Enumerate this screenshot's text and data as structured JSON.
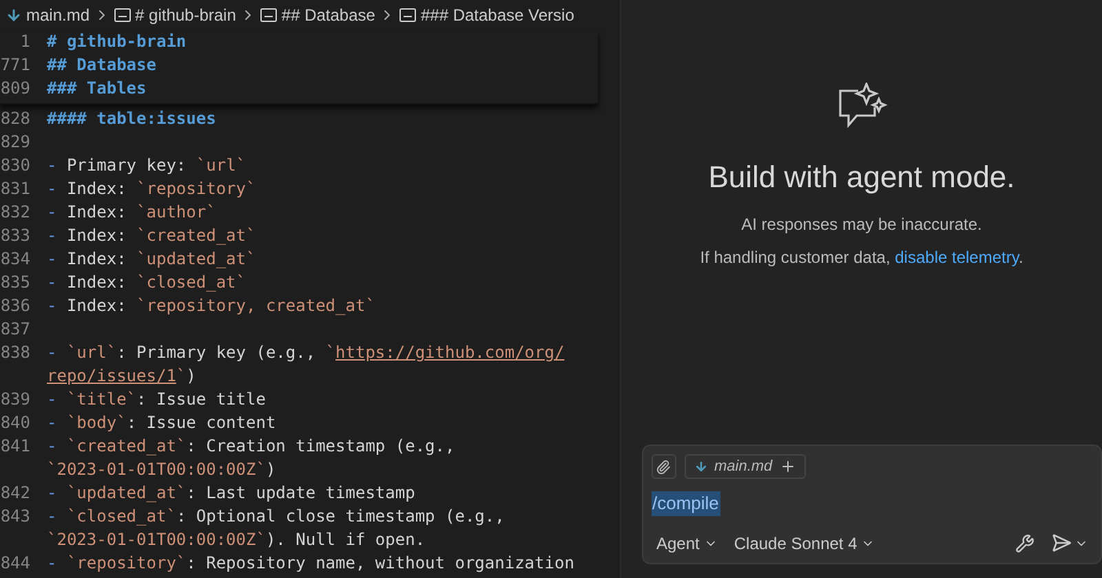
{
  "breadcrumb": [
    {
      "kind": "file",
      "label": "main.md"
    },
    {
      "kind": "symbol",
      "label": "# github-brain"
    },
    {
      "kind": "symbol",
      "label": "## Database"
    },
    {
      "kind": "symbol",
      "label": "### Database Versio"
    }
  ],
  "sticky_lines": [
    {
      "number": "1",
      "segments": [
        {
          "kind": "heading",
          "text": "# github-brain"
        }
      ]
    },
    {
      "number": "771",
      "segments": [
        {
          "kind": "heading",
          "text": "## Database"
        }
      ]
    },
    {
      "number": "809",
      "segments": [
        {
          "kind": "heading",
          "text": "### Tables"
        }
      ]
    }
  ],
  "lines": [
    {
      "number": "828",
      "segments": [
        {
          "kind": "heading",
          "text": "#### table:issues"
        }
      ]
    },
    {
      "number": "829"
    },
    {
      "number": "830",
      "segments": [
        {
          "kind": "marker",
          "text": "-"
        },
        {
          "kind": "text",
          "text": " Primary key: "
        },
        {
          "kind": "code",
          "text": "`url`"
        }
      ]
    },
    {
      "number": "831",
      "segments": [
        {
          "kind": "marker",
          "text": "-"
        },
        {
          "kind": "text",
          "text": " Index: "
        },
        {
          "kind": "code",
          "text": "`repository`"
        }
      ]
    },
    {
      "number": "832",
      "segments": [
        {
          "kind": "marker",
          "text": "-"
        },
        {
          "kind": "text",
          "text": " Index: "
        },
        {
          "kind": "code",
          "text": "`author`"
        }
      ]
    },
    {
      "number": "833",
      "segments": [
        {
          "kind": "marker",
          "text": "-"
        },
        {
          "kind": "text",
          "text": " Index: "
        },
        {
          "kind": "code",
          "text": "`created_at`"
        }
      ]
    },
    {
      "number": "834",
      "segments": [
        {
          "kind": "marker",
          "text": "-"
        },
        {
          "kind": "text",
          "text": " Index: "
        },
        {
          "kind": "code",
          "text": "`updated_at`"
        }
      ]
    },
    {
      "number": "835",
      "segments": [
        {
          "kind": "marker",
          "text": "-"
        },
        {
          "kind": "text",
          "text": " Index: "
        },
        {
          "kind": "code",
          "text": "`closed_at`"
        }
      ]
    },
    {
      "number": "836",
      "segments": [
        {
          "kind": "marker",
          "text": "-"
        },
        {
          "kind": "text",
          "text": " Index: "
        },
        {
          "kind": "code",
          "text": "`repository, created_at`"
        }
      ]
    },
    {
      "number": "837"
    },
    {
      "number": "838",
      "segments": [
        {
          "kind": "marker",
          "text": "- "
        },
        {
          "kind": "code",
          "text": "`url`"
        },
        {
          "kind": "text",
          "text": ": Primary key (e.g., "
        },
        {
          "kind": "code",
          "text": "`"
        },
        {
          "kind": "link",
          "text": "https://github.com/org/"
        }
      ]
    },
    {
      "segments": [
        {
          "kind": "link",
          "text": "repo/issues/1"
        },
        {
          "kind": "code",
          "text": "`"
        },
        {
          "kind": "text",
          "text": ")"
        }
      ]
    },
    {
      "number": "839",
      "segments": [
        {
          "kind": "marker",
          "text": "- "
        },
        {
          "kind": "code",
          "text": "`title`"
        },
        {
          "kind": "text",
          "text": ": Issue title"
        }
      ]
    },
    {
      "number": "840",
      "segments": [
        {
          "kind": "marker",
          "text": "- "
        },
        {
          "kind": "code",
          "text": "`body`"
        },
        {
          "kind": "text",
          "text": ": Issue content"
        }
      ]
    },
    {
      "number": "841",
      "segments": [
        {
          "kind": "marker",
          "text": "- "
        },
        {
          "kind": "code",
          "text": "`created_at`"
        },
        {
          "kind": "text",
          "text": ": Creation timestamp (e.g.,"
        }
      ]
    },
    {
      "segments": [
        {
          "kind": "code",
          "text": "`2023-01-01T00:00:00Z`"
        },
        {
          "kind": "text",
          "text": ")"
        }
      ]
    },
    {
      "number": "842",
      "segments": [
        {
          "kind": "marker",
          "text": "- "
        },
        {
          "kind": "code",
          "text": "`updated_at`"
        },
        {
          "kind": "text",
          "text": ": Last update timestamp"
        }
      ]
    },
    {
      "number": "843",
      "segments": [
        {
          "kind": "marker",
          "text": "- "
        },
        {
          "kind": "code",
          "text": "`closed_at`"
        },
        {
          "kind": "text",
          "text": ": Optional close timestamp (e.g.,"
        }
      ]
    },
    {
      "segments": [
        {
          "kind": "code",
          "text": "`2023-01-01T00:00:00Z`"
        },
        {
          "kind": "text",
          "text": "). Null if open."
        }
      ]
    },
    {
      "number": "844",
      "segments": [
        {
          "kind": "marker",
          "text": "- "
        },
        {
          "kind": "code",
          "text": "`repository`"
        },
        {
          "kind": "text",
          "text": ": Repository name, without organization"
        }
      ]
    }
  ],
  "chat": {
    "title": "Build with agent mode.",
    "notice": "AI responses may be inaccurate.",
    "telemetry_text": "If handling customer data, ",
    "telemetry_link": "disable telemetry",
    "telemetry_end": ".",
    "attachment": "main.md",
    "prompt": "/compile",
    "mode": "Agent",
    "model": "Claude Sonnet 4"
  }
}
